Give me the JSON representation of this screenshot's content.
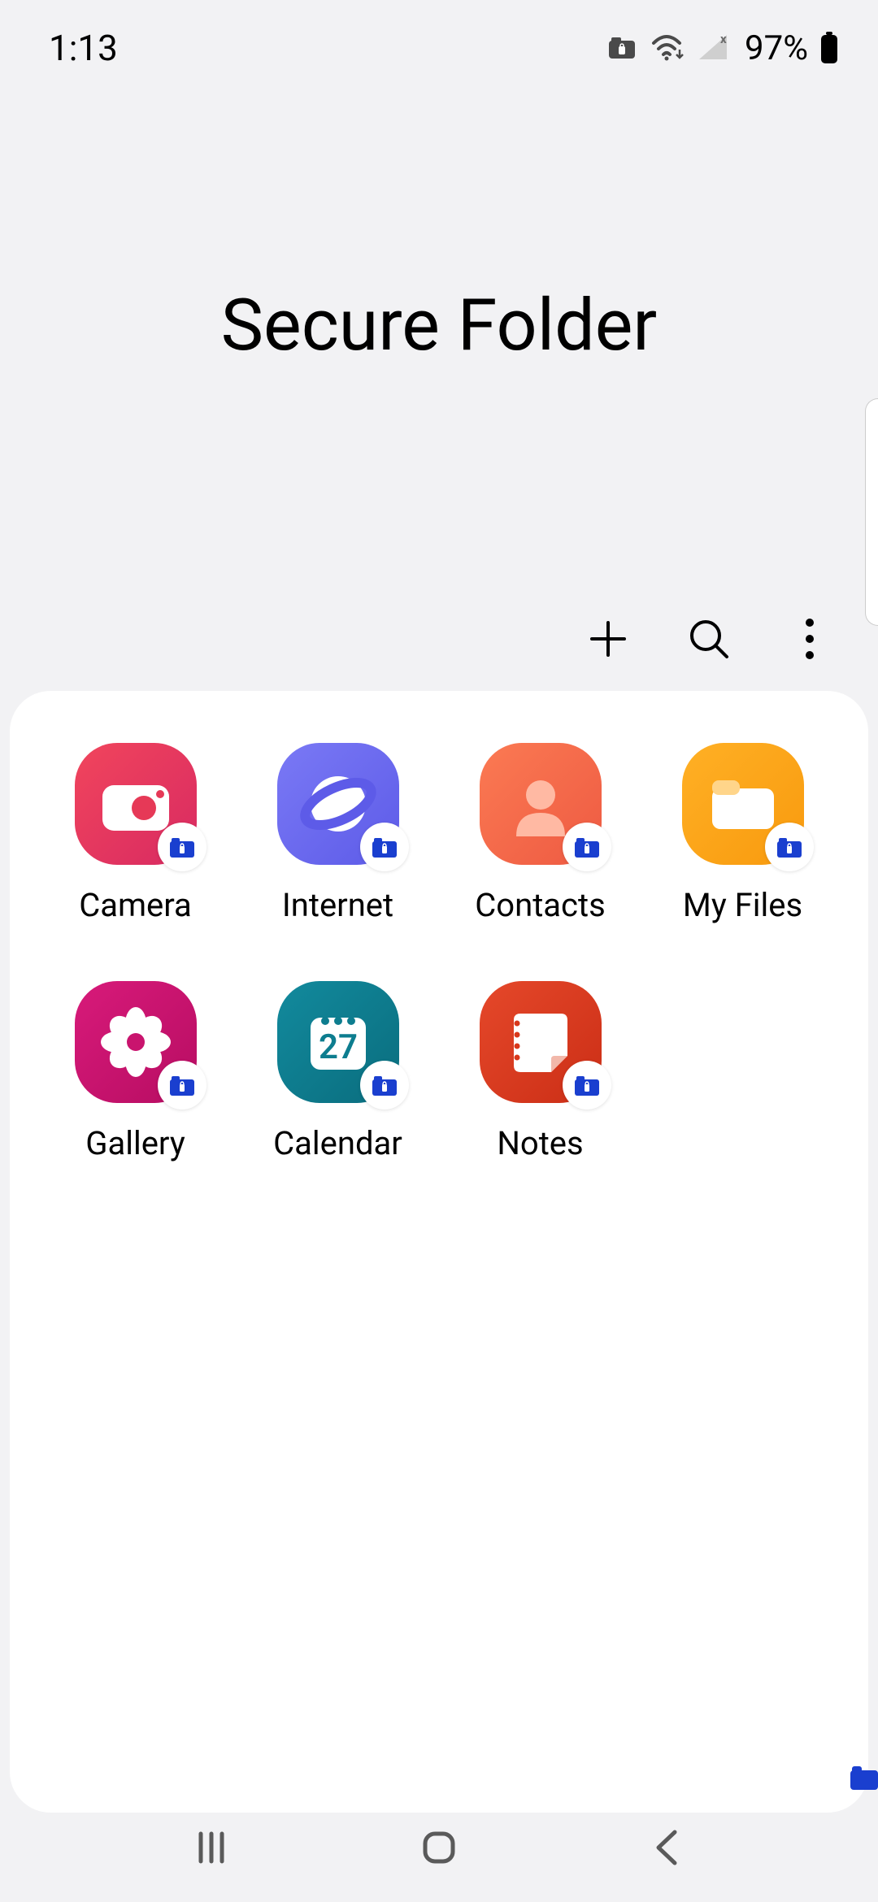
{
  "status": {
    "time": "1:13",
    "battery": "97%"
  },
  "header": {
    "title": "Secure Folder"
  },
  "apps": [
    {
      "label": "Camera",
      "icon": "camera",
      "bg": "#e63957"
    },
    {
      "label": "Internet",
      "icon": "internet",
      "bg": "#6f6ff2"
    },
    {
      "label": "Contacts",
      "icon": "contacts",
      "bg": "#f56848"
    },
    {
      "label": "My Files",
      "icon": "files",
      "bg": "#fba419"
    },
    {
      "label": "Gallery",
      "icon": "gallery",
      "bg": "#c9146e"
    },
    {
      "label": "Calendar",
      "icon": "calendar",
      "bg": "#0d7d8f",
      "day": "27"
    },
    {
      "label": "Notes",
      "icon": "notes",
      "bg": "#d8381c"
    }
  ],
  "colors": {
    "lock_badge": "#1a3fcf"
  }
}
